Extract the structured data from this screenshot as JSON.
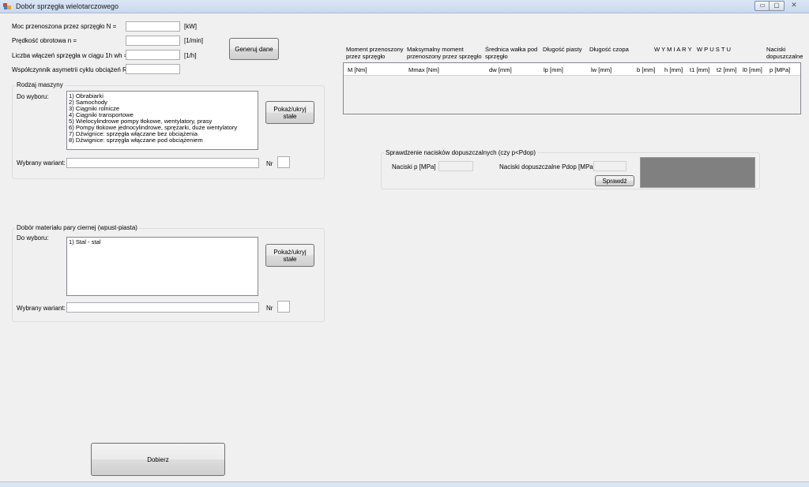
{
  "window": {
    "title": "Dobór sprzęgła wielotarczowego",
    "minimize_label": "▭",
    "restore_label": "▢",
    "close_label": "✕"
  },
  "inputs": {
    "power": {
      "label": "Moc przenoszona przez sprzęgło N =",
      "value": "",
      "unit": "[kW]"
    },
    "speed": {
      "label": "Prędkość obrotowa n =",
      "value": "",
      "unit": "[1/min]"
    },
    "engagements": {
      "label": "Liczba włączeń sprzęgła w ciągu 1h wh =",
      "value": "",
      "unit": "[1/h]"
    },
    "asymmetry": {
      "label": "Współczynnik asymetrii cyklu obciążeń R =",
      "value": ""
    }
  },
  "generate_button": "Generuj dane",
  "machine_group": {
    "title": "Rodzaj maszyny",
    "choose_label": "Do wyboru:",
    "items": [
      "1) Obrabiarki",
      "2) Samochody",
      "3) Ciągniki rolnicze",
      "4) Ciągniki transportowe",
      "5) Wielocylindrowe pompy tłokowe, wentylatory, prasy",
      "6) Pompy tłokowe jednocylindrowe, sprężarki, duże wentylatory",
      "7) Dźwignice: sprzęgła włączane bez obciążenia",
      "8) Dźwignice: sprzęgła włączane pod obciążeniem"
    ],
    "toggle_button": "Pokaż/ukryj stałe",
    "selected_label": "Wybrany wariant:",
    "selected_value": "",
    "nr_label": "Nr",
    "nr_value": ""
  },
  "material_group": {
    "title": "Dobór materiału pary ciernej (wpust-piasta)",
    "choose_label": "Do wyboru:",
    "items": [
      "1) Stal - stal"
    ],
    "toggle_button": "Pokaż/ukryj stałe",
    "selected_label": "Wybrany wariant:",
    "selected_value": "",
    "nr_label": "Nr",
    "nr_value": ""
  },
  "select_button": "Dobierz",
  "grid": {
    "top_headers": [
      "Moment przenoszony przez sprzęgło",
      "Maksymalny moment przenoszony przez sprzęgło",
      "Średnica wałka pod sprzęgło",
      "Długość piasty",
      "Długość czopa",
      "W Y M I A R Y   W P U S T U",
      "Naciski dopuszczalne"
    ],
    "columns": [
      "M [Nm]",
      "Mmax [Nm]",
      "dw [mm]",
      "lp [mm]",
      "lw [mm]",
      "b [mm]",
      "h [mm]",
      "t1 [mm]",
      "t2 [mm]",
      "l0 [mm]",
      "p [MPa]"
    ]
  },
  "pressure_group": {
    "title": "Sprawdzenie nacisków dopuszczalnych (czy p<Pdop)",
    "p_label": "Naciski p [MPa]",
    "p_value": "",
    "pdop_label": "Naciski dopuszczalne Pdop [MPa]",
    "pdop_value": "",
    "check_button": "Sprawdź",
    "result_color": "#808080"
  }
}
